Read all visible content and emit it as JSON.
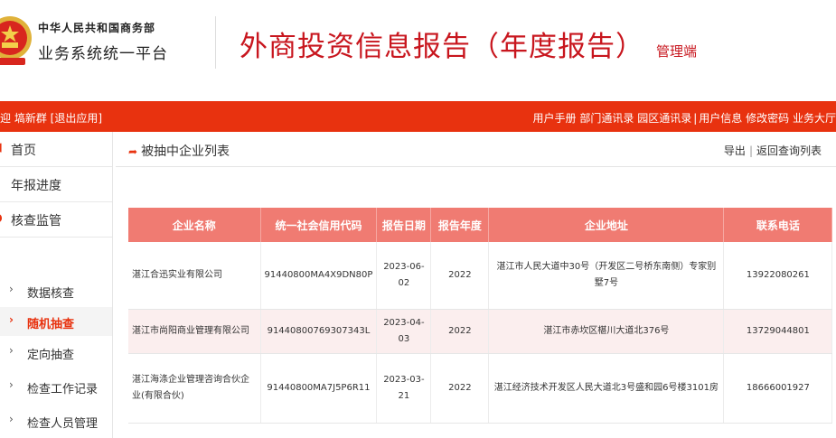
{
  "header": {
    "org_line1": "中华人民共和国商务部",
    "org_line2": "业务系统统一平台",
    "title": "外商投资信息报告（年度报告）",
    "title_sub": "管理端"
  },
  "topbar": {
    "user_text": "迎 塙新群",
    "logout_label": "[退出应用]",
    "links": [
      "用户手册",
      "部门通讯录",
      "园区通讯录",
      "用户信息",
      "修改密码",
      "业务大厅"
    ]
  },
  "sidebar": {
    "home": "首页",
    "progress": "年报进度",
    "supervision": "核查监管",
    "sub_items": [
      "数据核查",
      "随机抽查",
      "定向抽查",
      "检查工作记录",
      "检查人员管理"
    ]
  },
  "main": {
    "section_title": "被抽中企业列表",
    "export_label": "导出",
    "back_label": "返回查询列表",
    "table": {
      "headers": [
        "企业名称",
        "统一社会信用代码",
        "报告日期",
        "报告年度",
        "企业地址",
        "联系电话"
      ],
      "rows": [
        [
          "湛江合迅实业有限公司",
          "91440800MA4X9DN80P",
          "2023-06-02",
          "2022",
          "湛江市人民大道中30号（开发区二号桥东南侧）专家别墅7号",
          "13922080261"
        ],
        [
          "湛江市尚阳商业管理有限公司",
          "91440800769307343L",
          "2023-04-03",
          "2022",
          "湛江市赤坎区椹川大道北376号",
          "13729044801"
        ],
        [
          "湛江海涤企业管理咨询合伙企业(有限合伙)",
          "91440800MA7J5P6R11",
          "2023-03-21",
          "2022",
          "湛江经济技术开发区人民大道北3号盛和园6号楼3101房",
          "18666001927"
        ]
      ]
    }
  },
  "colors": {
    "brand_red": "#c8161e",
    "bar_red": "#e8320f",
    "table_header": "#f07b72"
  }
}
